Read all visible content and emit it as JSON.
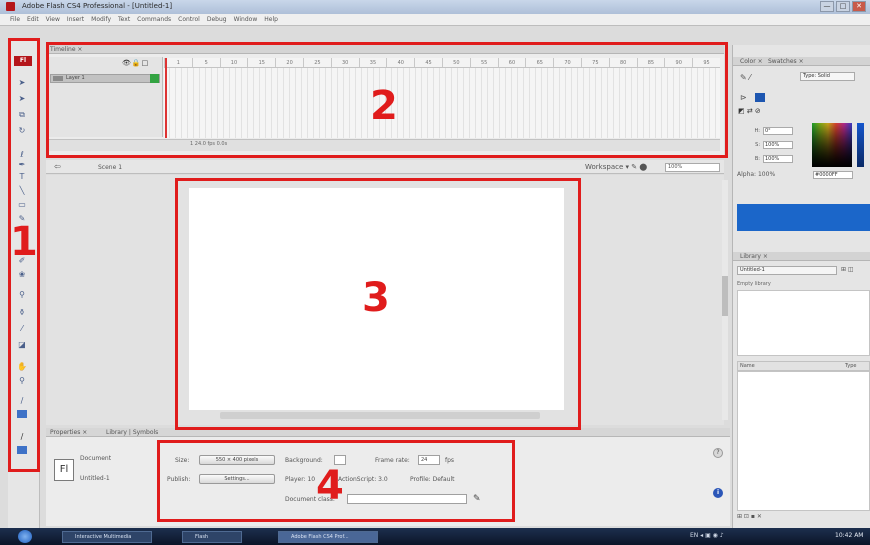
{
  "window": {
    "title": "Adobe Flash CS4 Professional - [Untitled-1]",
    "controls": [
      "—",
      "□",
      "✕"
    ]
  },
  "menu": [
    "File",
    "Edit",
    "View",
    "Insert",
    "Modify",
    "Text",
    "Commands",
    "Control",
    "Debug",
    "Window",
    "Help"
  ],
  "tools": {
    "logo": "Fl",
    "items": [
      {
        "icon": "selection-tool-icon",
        "glyph": "➤"
      },
      {
        "icon": "subselection-tool-icon",
        "glyph": "➤"
      },
      {
        "icon": "free-transform-tool-icon",
        "glyph": "⧉"
      },
      {
        "icon": "3d-rotation-tool-icon",
        "glyph": "↻"
      },
      {
        "icon": "lasso-tool-icon",
        "glyph": "ℓ"
      },
      {
        "icon": "pen-tool-icon",
        "glyph": "✒"
      },
      {
        "icon": "text-tool-icon",
        "glyph": "T"
      },
      {
        "icon": "line-tool-icon",
        "glyph": "╲"
      },
      {
        "icon": "rectangle-tool-icon",
        "glyph": "▭"
      },
      {
        "icon": "pencil-tool-icon",
        "glyph": "✎"
      },
      {
        "icon": "brush-tool-icon",
        "glyph": "✐"
      },
      {
        "icon": "deco-tool-icon",
        "glyph": "❀"
      },
      {
        "icon": "bone-tool-icon",
        "glyph": "⚲"
      },
      {
        "icon": "paint-bucket-tool-icon",
        "glyph": "⚱"
      },
      {
        "icon": "eyedropper-tool-icon",
        "glyph": "⁄"
      },
      {
        "icon": "eraser-tool-icon",
        "glyph": "◪"
      },
      {
        "icon": "hand-tool-icon",
        "glyph": "✋"
      },
      {
        "icon": "zoom-tool-icon",
        "glyph": "⚲"
      },
      {
        "icon": "stroke-color-icon",
        "glyph": "∕"
      },
      {
        "icon": "fill-color-icon",
        "glyph": "∕"
      }
    ]
  },
  "timeline": {
    "tab": "Timeline ×",
    "layer": "Layer 1",
    "header_icons": "👁🔒□",
    "ruler": [
      "1",
      "5",
      "10",
      "15",
      "20",
      "25",
      "30",
      "35",
      "40",
      "45",
      "50",
      "55",
      "60",
      "65",
      "70",
      "75",
      "80",
      "85",
      "90",
      "95"
    ],
    "footer": "1   24.0 fps   0.0s"
  },
  "stage_bar": {
    "scene": "Scene 1",
    "zoom": "100%",
    "right_icons": "Workspace ▾  ✎ ⬤"
  },
  "properties": {
    "tab1": "Properties ×",
    "tab2": "Library | Symbols",
    "doc_icon": "Fl",
    "doc_type": "Document",
    "doc_name": "Untitled-1",
    "size_label": "Size:",
    "size_value": "550 × 400 pixels",
    "background_label": "Background:",
    "frame_rate_label": "Frame rate:",
    "frame_rate_value": "24",
    "fps_label": "fps",
    "publish_label": "Publish:",
    "settings_button": "Settings...",
    "player_label": "Player: 10",
    "actionscript_label": "ActionScript: 3.0",
    "profile_label": "Profile: Default",
    "doc_class_label": "Document class:",
    "help_icon": "?",
    "info_icon": "i"
  },
  "color_panel": {
    "tab1": "Color ×",
    "tab2": "Swatches ×",
    "type": "Type: Solid",
    "hsb": [
      {
        "label": "H:",
        "value": "0°"
      },
      {
        "label": "S:",
        "value": "100%"
      },
      {
        "label": "B:",
        "value": "100%"
      }
    ],
    "alpha_label": "Alpha: 100%",
    "hex": "#0000FF",
    "fill_color": "#1b66c9"
  },
  "library_panel": {
    "tab": "Library ×",
    "select": "Untitled-1",
    "empty_text": "Empty library",
    "col_name": "Name",
    "col_type": "Type",
    "footer": "⊞ ⊡ ▪  ✕"
  },
  "taskbar": {
    "tasks": [
      "Interactive Multimedia",
      "Flash",
      "Adobe Flash CS4 Prof..."
    ],
    "tray": "EN  ◂  ▣  ◉  ♪",
    "clock": "10:42 AM"
  },
  "annotations": [
    "1",
    "2",
    "3",
    "4"
  ],
  "colors": {
    "annotation": "#e01c1c",
    "accent": "#1b66c9"
  }
}
